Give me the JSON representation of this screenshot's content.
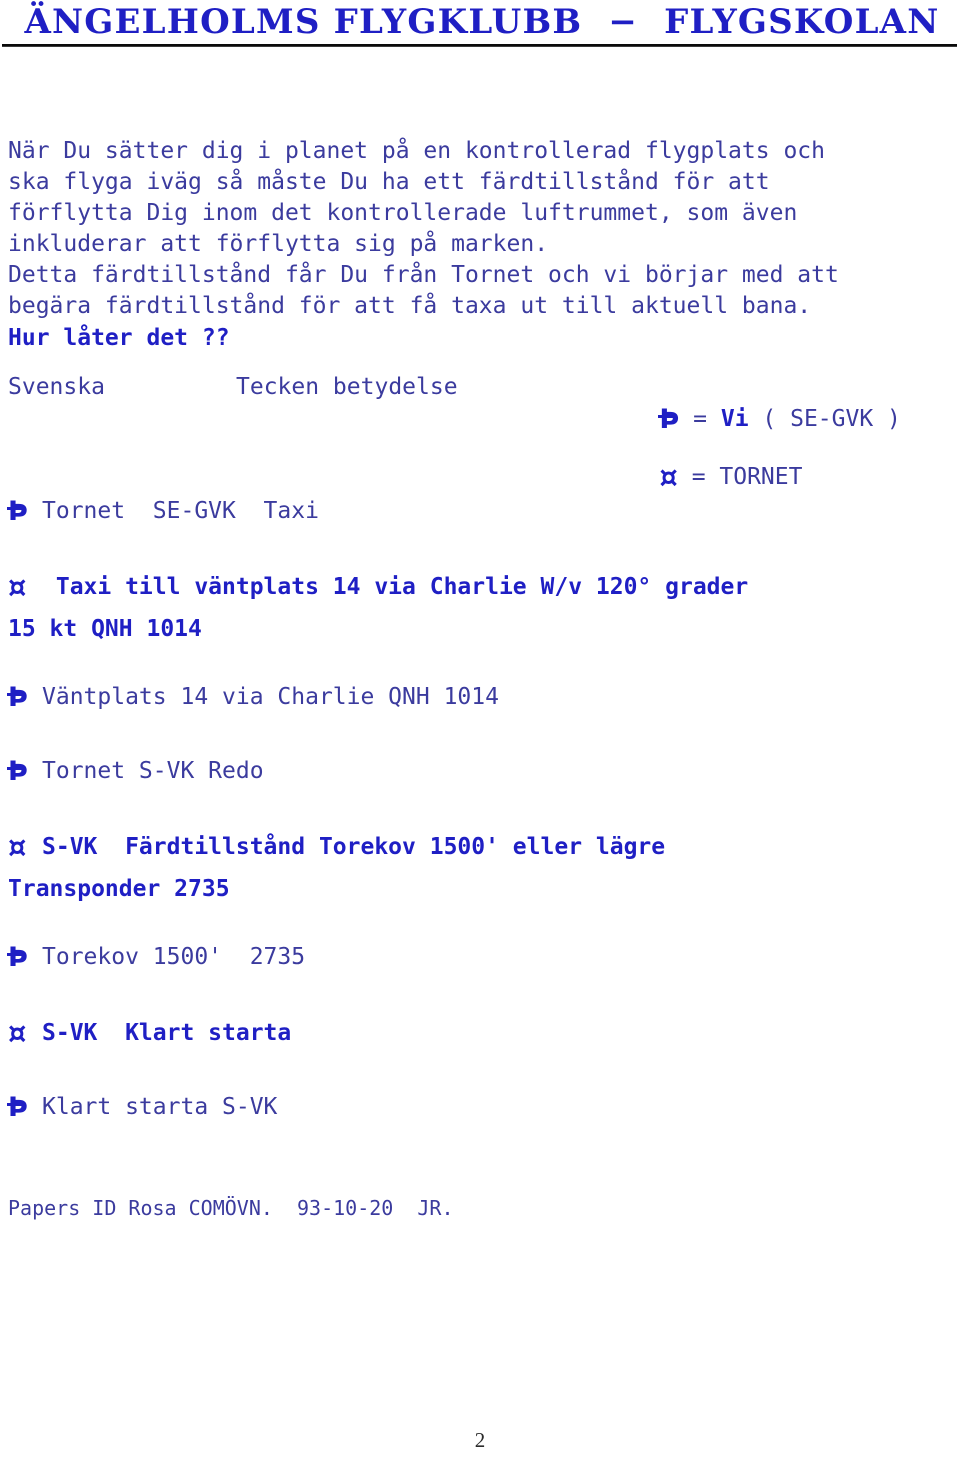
{
  "header": {
    "title": "ÄNGELHOLMS FLYGKLUBB  −  FLYGSKOLAN",
    "rule_color": "#0a0a0a"
  },
  "colors": {
    "heading_blue": "#1f1fc4",
    "body_blue": "#3b3b9e",
    "page_number": "#2b2b2b",
    "background": "#ffffff"
  },
  "intro": {
    "paragraph_1": "När Du sätter dig i planet på en kontrollerad flygplats och\nska flyga iväg så måste Du ha ett färdtillstånd för att\nförflytta Dig inom det kontrollerade luftrummet, som även\ninkluderar att förflytta sig på marken.",
    "paragraph_2": "Detta färdtillstånd får Du från Tornet och vi börjar med att\nbegära färdtillstånd för att få taxa ut till aktuell bana.",
    "question": "Hur låter det ??"
  },
  "legend": {
    "column_headers": [
      "Svenska",
      "Tecken betydelse"
    ],
    "entries": [
      {
        "symbol": "Þ",
        "symbol_name": "aircraft-callsign-symbol",
        "equals": " = ",
        "value_bold": "Vi",
        "value_rest": " ( SE-GVK )"
      },
      {
        "symbol": "¤",
        "symbol_name": "tower-symbol",
        "equals": " = ",
        "value_bold": "",
        "value_rest": "TORNET"
      }
    ]
  },
  "exchange": {
    "lines": [
      {
        "speaker": "aircraft",
        "symbol": "Þ",
        "text": "Tornet  SE-GVK  Taxi",
        "bold": false,
        "continuation": ""
      },
      {
        "speaker": "tower",
        "symbol": "¤",
        "text": " Taxi till väntplats 14 via Charlie W/v 120° grader",
        "bold": true,
        "continuation": "15 kt QNH 1014"
      },
      {
        "speaker": "aircraft",
        "symbol": "Þ",
        "text": "Väntplats 14 via Charlie QNH 1014",
        "bold": false,
        "continuation": ""
      },
      {
        "speaker": "aircraft",
        "symbol": "Þ",
        "text": "Tornet S-VK Redo",
        "bold": false,
        "continuation": ""
      },
      {
        "speaker": "tower",
        "symbol": "¤",
        "text": "S-VK  Färdtillstånd Torekov 1500' eller lägre",
        "bold": true,
        "continuation": "Transponder 2735"
      },
      {
        "speaker": "aircraft",
        "symbol": "Þ",
        "text": "Torekov 1500'  2735",
        "bold": false,
        "continuation": ""
      },
      {
        "speaker": "tower",
        "symbol": "¤",
        "text": "S-VK  Klart starta",
        "bold": true,
        "continuation": ""
      },
      {
        "speaker": "aircraft",
        "symbol": "Þ",
        "text": "Klart starta S-VK",
        "bold": false,
        "continuation": ""
      }
    ]
  },
  "footer": {
    "note": "Papers ID Rosa COMÖVN.  93-10-20  JR.",
    "page_number": "2"
  }
}
